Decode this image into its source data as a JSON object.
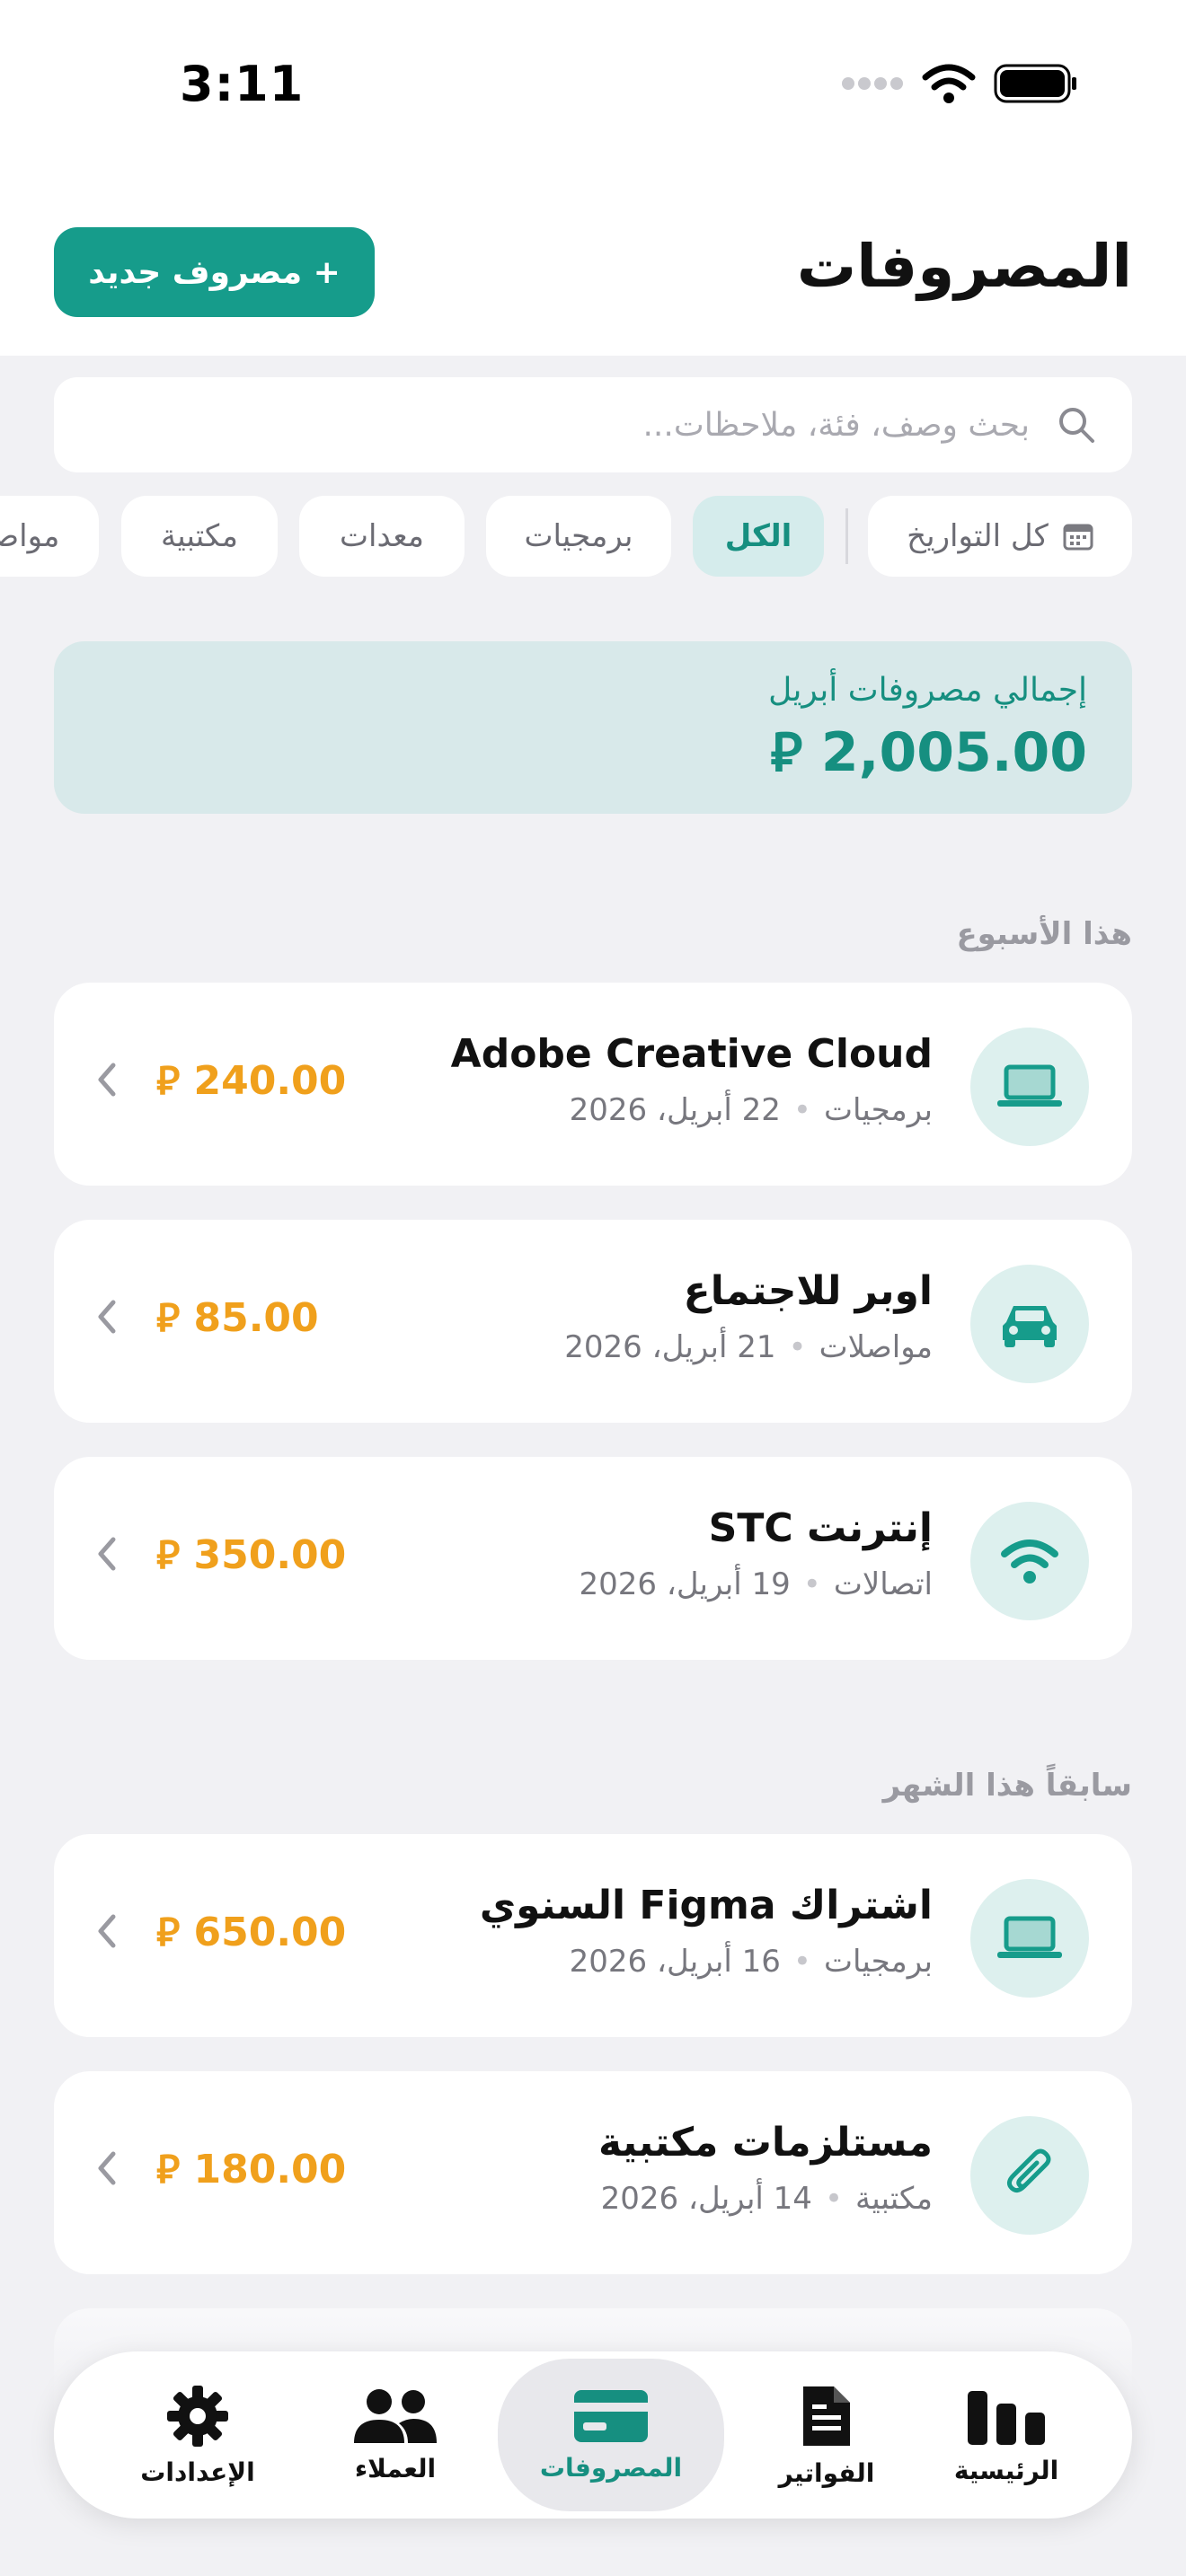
{
  "status_bar": {
    "time": "3:11"
  },
  "header": {
    "title": "المصروفات",
    "new_button_label": "+ مصروف جديد"
  },
  "search": {
    "placeholder": "بحث وصف، فئة، ملاحظات..."
  },
  "filters": {
    "date_label": "كل التواريخ",
    "chips": [
      "الكل",
      "برمجيات",
      "معدات",
      "مكتبية",
      "مواصلات"
    ],
    "selected": "الكل"
  },
  "total": {
    "label": "إجمالي مصروفات أبريل",
    "amount": "2,005.00",
    "currency": "⃁"
  },
  "sections": [
    {
      "title": "هذا الأسبوع",
      "items": [
        {
          "name": "Adobe Creative Cloud",
          "category": "برمجيات",
          "date": "22 أبريل، 2026",
          "amount": "240.00",
          "icon": "laptop-icon"
        },
        {
          "name": "اوبر للاجتماع",
          "category": "مواصلات",
          "date": "21 أبريل، 2026",
          "amount": "85.00",
          "icon": "car-icon"
        },
        {
          "name": "إنترنت STC",
          "category": "اتصالات",
          "date": "19 أبريل، 2026",
          "amount": "350.00",
          "icon": "wifi-icon"
        }
      ]
    },
    {
      "title": "سابقاً هذا الشهر",
      "items": [
        {
          "name": "اشتراك Figma السنوي",
          "category": "برمجيات",
          "date": "16 أبريل، 2026",
          "amount": "650.00",
          "icon": "laptop-icon"
        },
        {
          "name": "مستلزمات مكتبية",
          "category": "مكتبية",
          "date": "14 أبريل، 2026",
          "amount": "180.00",
          "icon": "paperclip-icon"
        }
      ]
    }
  ],
  "nav": {
    "items": [
      "الرئيسية",
      "الفواتير",
      "المصروفات",
      "العملاء",
      "الإعدادات"
    ],
    "active": "المصروفات"
  },
  "colors": {
    "accent": "#169C8B",
    "amount": "#F0A01C",
    "total_bg": "#D8E9EA"
  }
}
